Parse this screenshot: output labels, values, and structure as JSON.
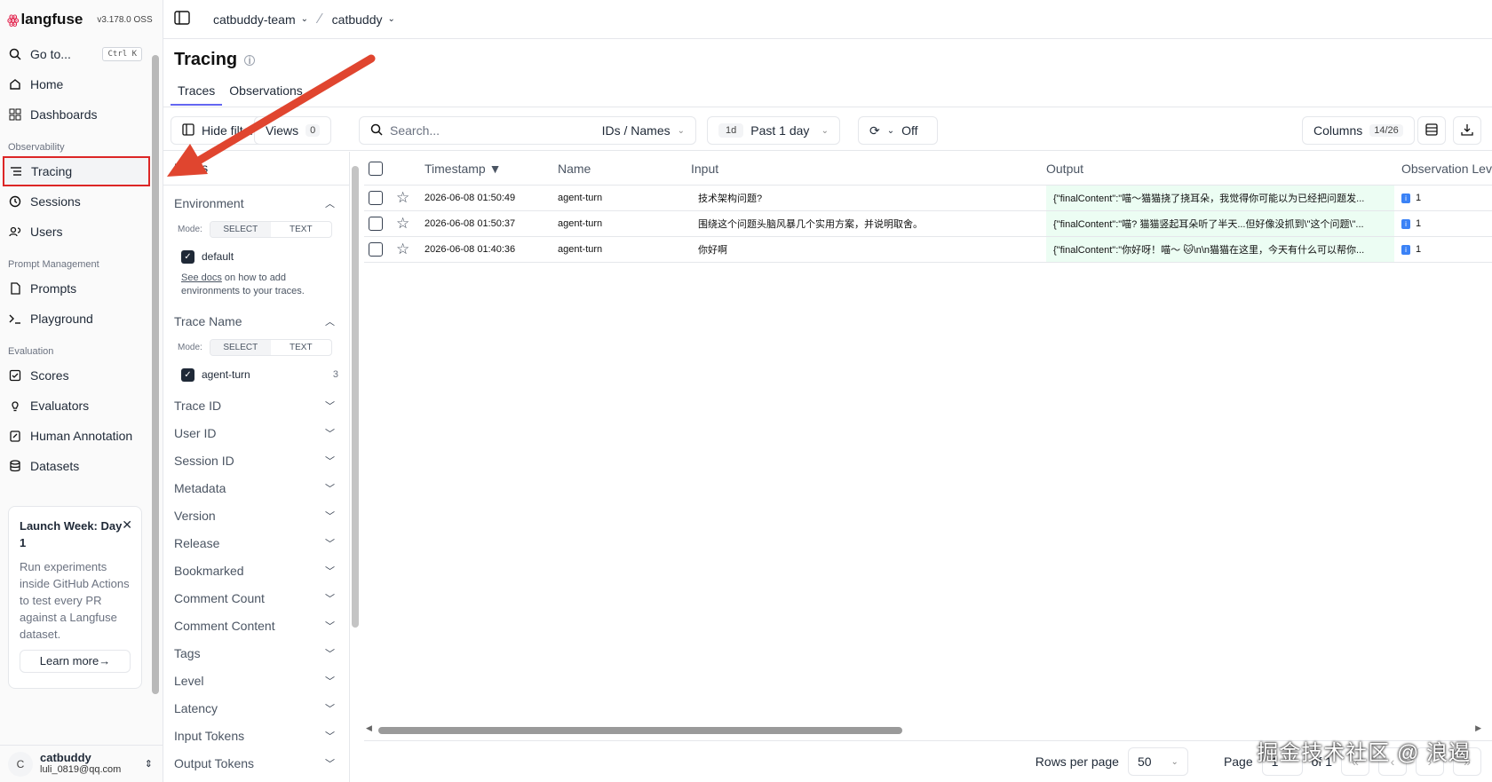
{
  "app": {
    "logo_mark": "ꙮ",
    "name": "langfuse",
    "version": "v3.178.0 OSS"
  },
  "topbar": {
    "org": "catbuddy-team",
    "project": "catbuddy"
  },
  "sidebar": {
    "goto": {
      "label": "Go to...",
      "shortcut": "Ctrl K"
    },
    "items": [
      {
        "label": "Home",
        "icon": "home-icon"
      },
      {
        "label": "Dashboards",
        "icon": "dashboard-icon"
      }
    ],
    "observability": {
      "title": "Observability",
      "items": [
        "Tracing",
        "Sessions",
        "Users"
      ]
    },
    "prompt_management": {
      "title": "Prompt Management",
      "items": [
        "Prompts",
        "Playground"
      ]
    },
    "evaluation": {
      "title": "Evaluation",
      "items": [
        "Scores",
        "Evaluators",
        "Human Annotation",
        "Datasets"
      ]
    },
    "promo": {
      "title": "Launch Week: Day 1",
      "body": "Run experiments inside GitHub Actions to test every PR against a Langfuse dataset.",
      "button": "Learn more→"
    },
    "user": {
      "initial": "C",
      "name": "catbuddy",
      "email": "luli_0819@qq.com"
    }
  },
  "page": {
    "title": "Tracing",
    "tabs": [
      "Traces",
      "Observations"
    ]
  },
  "toolbar": {
    "hide_filters": "Hide filters",
    "views_label": "Views",
    "views_count": "0",
    "search_placeholder": "Search...",
    "search_mode": "IDs / Names",
    "range_short": "1d",
    "range_label": "Past 1 day",
    "refresh_state": "Off",
    "columns_label": "Columns",
    "columns_count": "14/26"
  },
  "filters": {
    "header": "Filters",
    "environment": {
      "label": "Environment",
      "mode_label": "Mode:",
      "modes": [
        "SELECT",
        "TEXT"
      ],
      "option": "default",
      "hint_link": "See docs",
      "hint_text": " on how to add environments to your traces."
    },
    "trace_name": {
      "label": "Trace Name",
      "mode_label": "Mode:",
      "modes": [
        "SELECT",
        "TEXT"
      ],
      "option": "agent-turn",
      "count": "3"
    },
    "collapsed": [
      "Trace ID",
      "User ID",
      "Session ID",
      "Metadata",
      "Version",
      "Release",
      "Bookmarked",
      "Comment Count",
      "Comment Content",
      "Tags",
      "Level",
      "Latency",
      "Input Tokens",
      "Output Tokens"
    ]
  },
  "table": {
    "columns": {
      "timestamp": "Timestamp ▼",
      "name": "Name",
      "input": "Input",
      "output": "Output",
      "level": "Observation Lev"
    },
    "rows": [
      {
        "timestamp": "2026-06-08 01:50:49",
        "name": "agent-turn",
        "input": "技术架构问题?",
        "output": "{\"finalContent\":\"喵～猫猫挠了挠耳朵，我觉得你可能以为已经把问题发...",
        "level": "1"
      },
      {
        "timestamp": "2026-06-08 01:50:37",
        "name": "agent-turn",
        "input": "围绕这个问题头脑风暴几个实用方案，并说明取舍。",
        "output": "{\"finalContent\":\"喵? 猫猫竖起耳朵听了半天...但好像没抓到\\\"这个问题\\\"...",
        "level": "1"
      },
      {
        "timestamp": "2026-06-08 01:40:36",
        "name": "agent-turn",
        "input": "你好啊",
        "output": "{\"finalContent\":\"你好呀！喵～ 🐱\\n\\n猫猫在这里，今天有什么可以帮你...",
        "level": "1"
      }
    ]
  },
  "pager": {
    "rows_label": "Rows per page",
    "rows_value": "50",
    "page_label": "Page",
    "page_value": "1",
    "of_label": "of 1"
  },
  "watermark": "掘金技术社区 @ 浪遏",
  "colors": {
    "accent": "#6366f1",
    "highlight": "#dc2626",
    "output_bg": "#ecfdf3"
  }
}
